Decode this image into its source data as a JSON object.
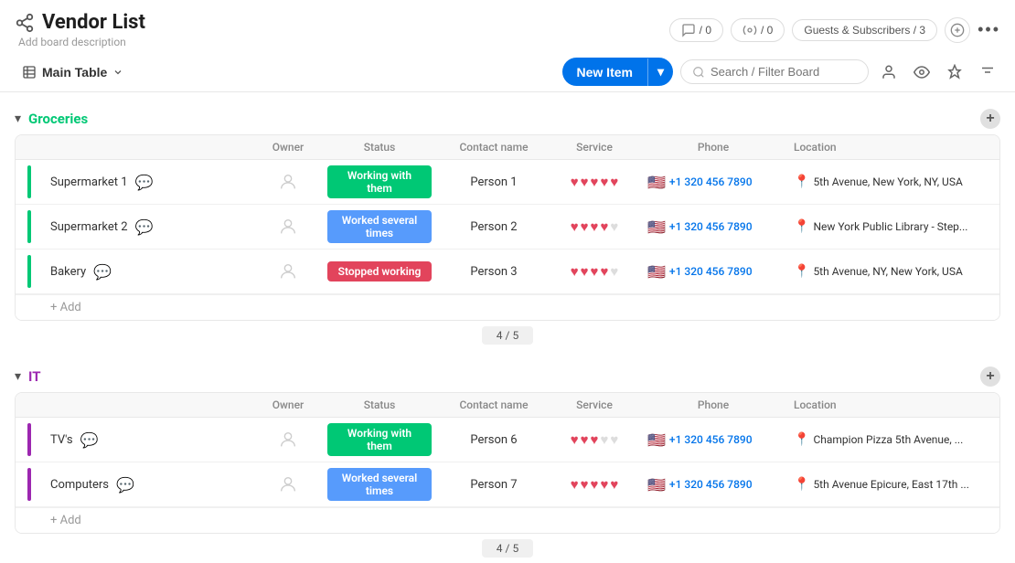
{
  "app": {
    "title": "Vendor List",
    "subtitle": "Add board description"
  },
  "header": {
    "activity_count": "/ 0",
    "automation_count": "/ 0",
    "guests_label": "Guests & Subscribers / 3",
    "more_icon": "•••"
  },
  "toolbar": {
    "main_table_label": "Main Table",
    "new_item_label": "New Item",
    "search_placeholder": "Search / Filter Board"
  },
  "groceries_section": {
    "title": "Groceries",
    "col_owner": "Owner",
    "col_status": "Status",
    "col_contact": "Contact name",
    "col_service": "Service",
    "col_phone": "Phone",
    "col_location": "Location",
    "summary": "4 / 5",
    "rows": [
      {
        "name": "Supermarket 1",
        "status": "Working with them",
        "status_class": "status-working",
        "contact": "Person 1",
        "hearts": [
          1,
          1,
          1,
          1,
          1
        ],
        "phone": "+1 320 456 7890",
        "location": "5th Avenue, New York, NY, USA"
      },
      {
        "name": "Supermarket 2",
        "status": "Worked several times",
        "status_class": "status-worked",
        "contact": "Person 2",
        "hearts": [
          1,
          1,
          1,
          1,
          0
        ],
        "phone": "+1 320 456 7890",
        "location": "New York Public Library - Step..."
      },
      {
        "name": "Bakery",
        "status": "Stopped working",
        "status_class": "status-stopped",
        "contact": "Person 3",
        "hearts": [
          1,
          1,
          1,
          1,
          0
        ],
        "phone": "+1 320 456 7890",
        "location": "5th Avenue, NY, New York, USA"
      }
    ],
    "add_label": "+ Add"
  },
  "it_section": {
    "title": "IT",
    "col_owner": "Owner",
    "col_status": "Status",
    "col_contact": "Contact name",
    "col_service": "Service",
    "col_phone": "Phone",
    "col_location": "Location",
    "summary": "4 / 5",
    "rows": [
      {
        "name": "TV's",
        "status": "Working with them",
        "status_class": "status-working",
        "contact": "Person 6",
        "hearts": [
          1,
          1,
          1,
          0,
          0
        ],
        "phone": "+1 320 456 7890",
        "location": "Champion Pizza 5th Avenue, ..."
      },
      {
        "name": "Computers",
        "status": "Worked several times",
        "status_class": "status-worked",
        "contact": "Person 7",
        "hearts": [
          1,
          1,
          1,
          1,
          1
        ],
        "phone": "+1 320 456 7890",
        "location": "5th Avenue Epicure, East 17th ..."
      }
    ],
    "add_label": "+ Add"
  }
}
